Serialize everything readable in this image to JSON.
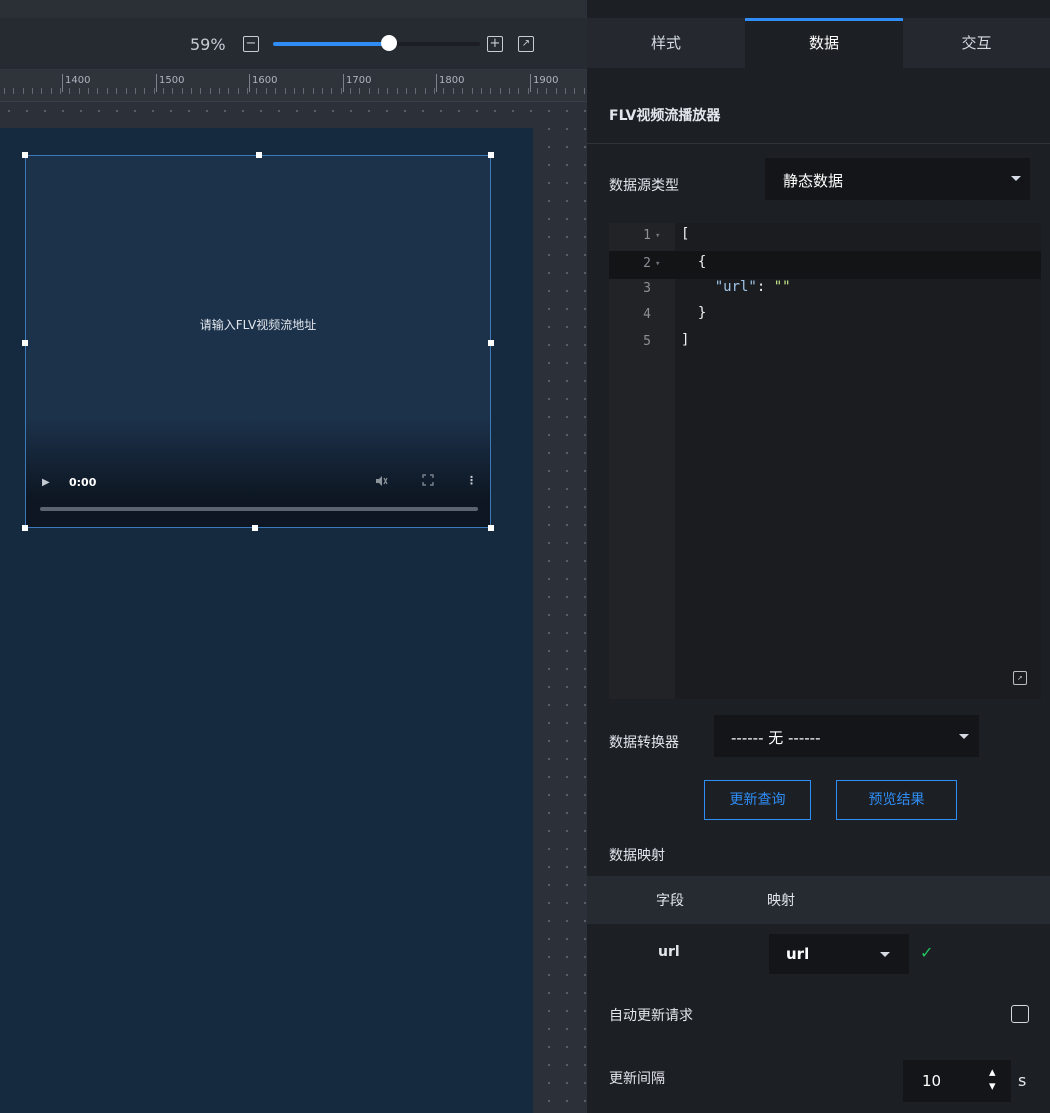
{
  "toolbar": {
    "zoom_label": "59%",
    "zoom_level": 0.56,
    "minus_icon": "−",
    "plus_icon": "+",
    "fit_icon": "↗"
  },
  "ruler": {
    "labels": [
      "1400",
      "1500",
      "1600",
      "1700",
      "1800",
      "1900"
    ]
  },
  "video": {
    "placeholder": "请输入FLV视频流地址",
    "time": "0:00",
    "icons": {
      "play": "▶",
      "mute": "🔇︎",
      "fullscreen": "⛶",
      "menu": "⋮"
    }
  },
  "tabs": {
    "style": "样式",
    "data": "数据",
    "interact": "交互",
    "active": "data"
  },
  "panel": {
    "component_title": "FLV视频流播放器",
    "source_type_label": "数据源类型",
    "source_type_value": "静态数据",
    "code_lines": [
      {
        "num": "1",
        "fold": true
      },
      {
        "num": "2",
        "fold": true
      },
      {
        "num": "3",
        "fold": false
      },
      {
        "num": "4",
        "fold": false
      },
      {
        "num": "5",
        "fold": false
      }
    ],
    "code": {
      "l1": "[",
      "l2": "  {",
      "l3_key": "\"url\"",
      "l3_sep": ": ",
      "l3_val": "\"\"",
      "l4": "  }",
      "l5": "]"
    },
    "converter_label": "数据转换器",
    "converter_value": "------ 无 ------",
    "update_query_button": "更新查询",
    "preview_button": "预览结果",
    "mapping_label": "数据映射",
    "mapping_header_field": "字段",
    "mapping_header_map": "映射",
    "mapping_row_field": "url",
    "mapping_row_value": "url",
    "auto_update_label": "自动更新请求",
    "auto_update_checked": false,
    "interval_label": "更新间隔",
    "interval_value": "10",
    "interval_unit": "s"
  },
  "colors": {
    "accent": "#2f8df5",
    "canvas_bg": "#15293f",
    "panel_bg": "#1c1f24",
    "success": "#22c55e"
  }
}
